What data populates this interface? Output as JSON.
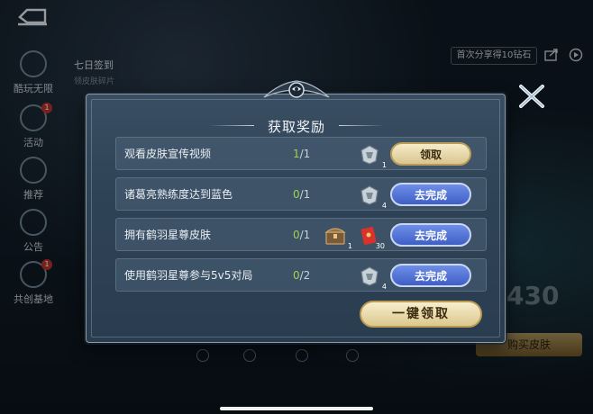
{
  "sidebar": {
    "items": [
      {
        "label": "酷玩无限"
      },
      {
        "label": "活动",
        "badge": "1"
      },
      {
        "label": "推荐"
      },
      {
        "label": "公告"
      },
      {
        "label": "共创基地",
        "badge": "1"
      }
    ]
  },
  "background": {
    "checkin_title": "七日签到",
    "checkin_sub": "领皮肤碎片",
    "share_label": "首次分享得10钻石",
    "big_number": "430",
    "buy_label": "购买皮肤"
  },
  "modal": {
    "title": "获取奖励",
    "rows": [
      {
        "task": "观看皮肤宣传视频",
        "current": "1",
        "total": "/1",
        "rewards": [
          {
            "icon": "skin-fragment-icon",
            "count": "1"
          }
        ],
        "button": "领取",
        "button_type": "claim"
      },
      {
        "task": "诸葛亮熟练度达到蓝色",
        "current": "0",
        "total": "/1",
        "rewards": [
          {
            "icon": "skin-fragment-icon",
            "count": "4"
          }
        ],
        "button": "去完成",
        "button_type": "go"
      },
      {
        "task": "拥有鹤羽星尊皮肤",
        "current": "0",
        "total": "/1",
        "rewards": [
          {
            "icon": "treasure-chest-icon",
            "count": "1"
          },
          {
            "icon": "red-envelope-icon",
            "count": "30"
          }
        ],
        "button": "去完成",
        "button_type": "go"
      },
      {
        "task": "使用鹤羽星尊参与5v5对局",
        "current": "0",
        "total": "/2",
        "rewards": [
          {
            "icon": "skin-fragment-icon",
            "count": "4"
          }
        ],
        "button": "去完成",
        "button_type": "go"
      }
    ],
    "claim_all_label": "一键领取"
  },
  "colors": {
    "progress_current": "#9ed24f",
    "claim_button": "#e8d9a8",
    "go_button": "#4a6ad0"
  }
}
